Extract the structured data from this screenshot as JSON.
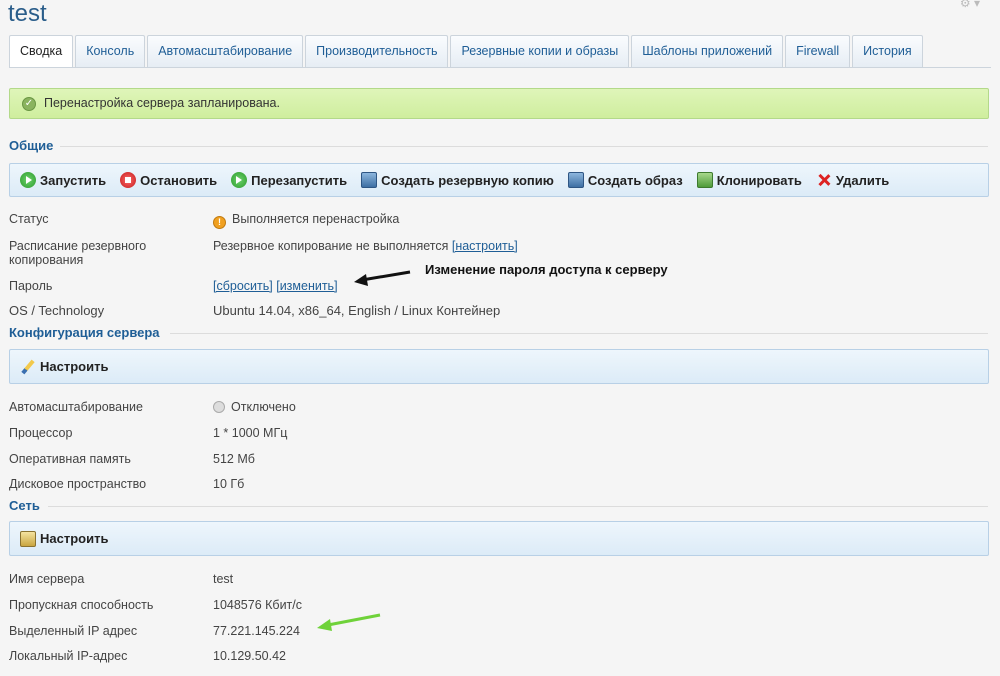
{
  "page": {
    "title": "test"
  },
  "tabs": [
    {
      "label": "Сводка",
      "active": true
    },
    {
      "label": "Консоль"
    },
    {
      "label": "Автомасштабирование"
    },
    {
      "label": "Производительность"
    },
    {
      "label": "Резервные копии и образы"
    },
    {
      "label": "Шаблоны приложений"
    },
    {
      "label": "Firewall"
    },
    {
      "label": "История"
    }
  ],
  "alert": {
    "text": "Перенастройка сервера запланирована."
  },
  "general": {
    "heading": "Общие",
    "actions": {
      "start": "Запустить",
      "stop": "Остановить",
      "restart": "Перезапустить",
      "backup": "Создать резервную копию",
      "image": "Создать образ",
      "clone": "Клонировать",
      "delete": "Удалить"
    },
    "status_label": "Статус",
    "status_value": "Выполняется перенастройка",
    "backup_label_1": "Расписание резервного",
    "backup_label_2": "копирования",
    "backup_value": "Резервное копирование не выполняется",
    "backup_link": "[настроить]",
    "password_label": "Пароль",
    "password_reset": "[сбросить]",
    "password_change": "[изменить]",
    "os_label": "OS / Technology",
    "os_value": "Ubuntu 14.04, x86_64, English / Linux Контейнер"
  },
  "annotation": {
    "text": "Изменение пароля доступа к серверу"
  },
  "config": {
    "heading": "Конфигурация сервера",
    "configure": "Настроить",
    "autoscale_label": "Автомасштабирование",
    "autoscale_value": "Отключено",
    "cpu_label": "Процессор",
    "cpu_value": "1 * 1000 МГц",
    "ram_label": "Оперативная память",
    "ram_value": "512 Мб",
    "disk_label": "Дисковое пространство",
    "disk_value": "10 Гб"
  },
  "network": {
    "heading": "Сеть",
    "configure": "Настроить",
    "hostname_label": "Имя сервера",
    "hostname_value": "test",
    "bandwidth_label": "Пропускная способность",
    "bandwidth_value": "1048576 Кбит/с",
    "ip_label": "Выделенный IP адрес",
    "ip_value": "77.221.145.224",
    "local_ip_label": "Локальный IP-адрес",
    "local_ip_value": "10.129.50.42"
  },
  "colors": {
    "accent": "#1f5e96",
    "success": "#cfee9e",
    "annotation_arrow_green": "#6fd23a"
  }
}
